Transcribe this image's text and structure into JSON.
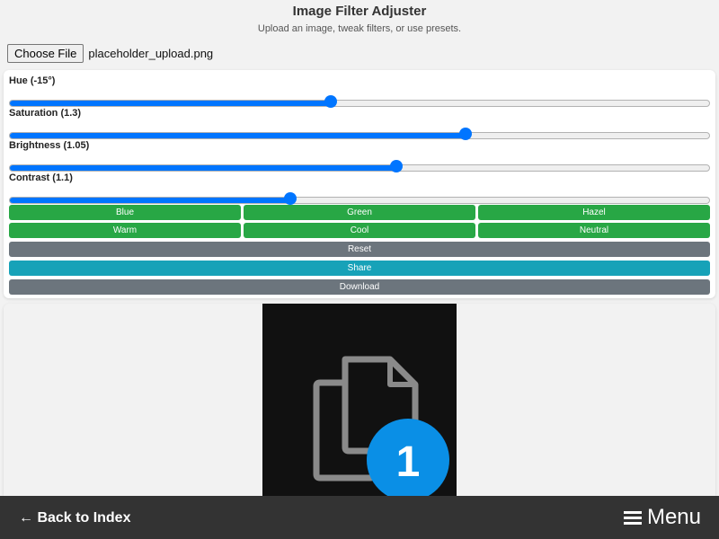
{
  "header": {
    "title": "Image Filter Adjuster",
    "subtitle": "Upload an image, tweak filters, or use presets."
  },
  "file_input": {
    "button_label": "Choose File",
    "file_name": "placeholder_upload.png"
  },
  "sliders": [
    {
      "label": "Hue (-15°)",
      "level": 0.459
    },
    {
      "label": "Saturation (1.3)",
      "level": 0.651
    },
    {
      "label": "Brightness (1.05)",
      "level": 0.553
    },
    {
      "label": "Contrast (1.1)",
      "level": 0.401
    }
  ],
  "presets": {
    "row1": [
      "Blue",
      "Green",
      "Hazel"
    ],
    "row2": [
      "Warm",
      "Cool",
      "Neutral"
    ]
  },
  "actions": {
    "reset_label": "Reset",
    "share_label": "Share",
    "download_label": "Download"
  },
  "preview": {
    "badge_number": "1",
    "icon": "copy-files-icon"
  },
  "footer": {
    "back_label": "← Back to Index",
    "menu_label": "Menu",
    "menu_icon": "hamburger-icon"
  },
  "colors": {
    "accent": "#0075ff",
    "preset": "#28a745",
    "secondary": "#6c757d",
    "share": "#17a2b8",
    "footer": "#333333",
    "badge": "#0a8fe6"
  }
}
